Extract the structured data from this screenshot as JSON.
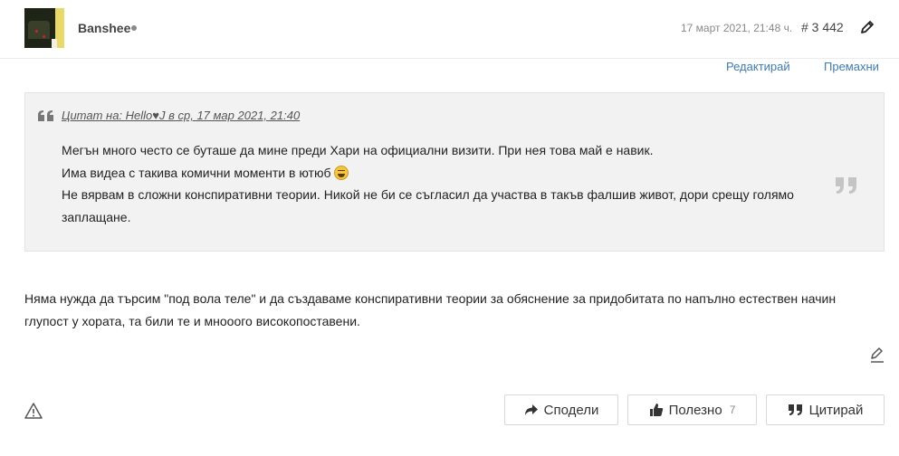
{
  "post": {
    "username": "Banshee",
    "date": "17 март 2021, 21:48 ч.",
    "number": "# 3 442"
  },
  "actions": {
    "edit": "Редактирай",
    "remove": "Премахни"
  },
  "quote": {
    "cite": "Цитат на: Hello♥J в ср, 17 мар 2021, 21:40",
    "line1": "Мегън много често се буташе да мине преди Хари на официални визити. При нея това май е навик.",
    "line2": "Има видеа с такива комични моменти в ютюб",
    "line3": "Не вярвам в сложни конспиративни теории. Никой не би се съгласил да участва в такъв фалшив живот, дори срещу голямо заплащане."
  },
  "body": {
    "text": "Няма нужда да търсим \"под вола теле\" и да създаваме конспиративни теории за обяснение за придобитата по напълно естествен начин глупост у  хората, та били те и мнооого високопоставени."
  },
  "footer": {
    "share": "Сподели",
    "useful": "Полезно",
    "useful_count": "7",
    "quote": "Цитирай"
  },
  "colors": {
    "link": "#3f7bb0",
    "quote_bg": "#f2f2f2",
    "muted": "#888888"
  },
  "icons": [
    "avatar",
    "online-dot",
    "pencil-icon",
    "quote-open-icon",
    "quote-close-icon",
    "grin-emoji-icon",
    "edit-pencil-icon",
    "warning-icon",
    "share-arrow-icon",
    "thumbs-up-icon",
    "quote-icon"
  ]
}
